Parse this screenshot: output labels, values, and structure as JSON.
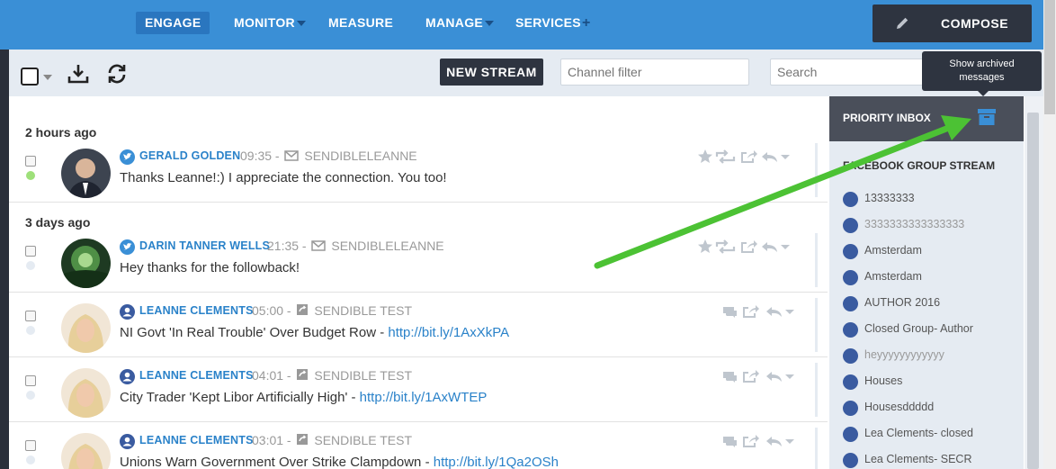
{
  "nav": {
    "items": [
      {
        "label": "ENGAGE",
        "active": true
      },
      {
        "label": "MONITOR",
        "caret": true
      },
      {
        "label": "MEASURE"
      },
      {
        "label": "MANAGE",
        "caret": true
      },
      {
        "label": "SERVICES",
        "plus": true
      }
    ],
    "compose_label": "COMPOSE"
  },
  "toolbar": {
    "new_stream_label": "NEW STREAM",
    "channel_filter_placeholder": "Channel filter",
    "search_placeholder": "Search",
    "download_icon": "download-icon",
    "refresh_icon": "refresh-icon"
  },
  "tooltip": {
    "line1": "Show archived",
    "line2": "messages"
  },
  "feed": {
    "sections": [
      {
        "header": "2 hours ago"
      },
      {
        "header": "3 days ago"
      }
    ],
    "messages": [
      {
        "network": "twitter",
        "author": "GERALD GOLDEN",
        "time": "09:35 -",
        "channel": "SENDIBLELEANNE",
        "text": "Thanks Leanne!:) I appreciate the connection. You too!",
        "link": "",
        "status": "green"
      },
      {
        "network": "twitter",
        "author": "DARIN TANNER WELLS",
        "time": "21:35 -",
        "channel": "SENDIBLELEANNE",
        "text": "Hey thanks for the followback!",
        "link": "",
        "status": "none"
      },
      {
        "network": "facebook",
        "author": "LEANNE CLEMENTS",
        "time": "05:00 -",
        "channel": "SENDIBLE TEST",
        "text": "NI Govt 'In Real Trouble' Over Budget Row - ",
        "link": "http://bit.ly/1AxXkPA",
        "status": "none"
      },
      {
        "network": "facebook",
        "author": "LEANNE CLEMENTS",
        "time": "04:01 -",
        "channel": "SENDIBLE TEST",
        "text": "City Trader 'Kept Libor Artificially High' - ",
        "link": "http://bit.ly/1AxWTEP",
        "status": "none"
      },
      {
        "network": "facebook",
        "author": "LEANNE CLEMENTS",
        "time": "03:01 -",
        "channel": "SENDIBLE TEST",
        "text": "Unions Warn Government Over Strike Clampdown - ",
        "link": "http://bit.ly/1Qa2OSh",
        "status": "none"
      }
    ]
  },
  "sidebar": {
    "priority_label": "PRIORITY INBOX",
    "group_title": "FACEBOOK GROUP STREAM",
    "streams": [
      "13333333",
      "3333333333333333",
      "Amsterdam",
      "Amsterdam",
      "AUTHOR 2016",
      "Closed Group- Author",
      "heyyyyyyyyyyyy",
      "Houses",
      "Housesddddd",
      "Lea Clements- closed",
      "Lea Clements- SECR"
    ]
  },
  "colors": {
    "nav_bg": "#3a8fd6",
    "dark_button": "#2e3440",
    "link": "#2a82c9",
    "arrow": "#4cc234"
  }
}
